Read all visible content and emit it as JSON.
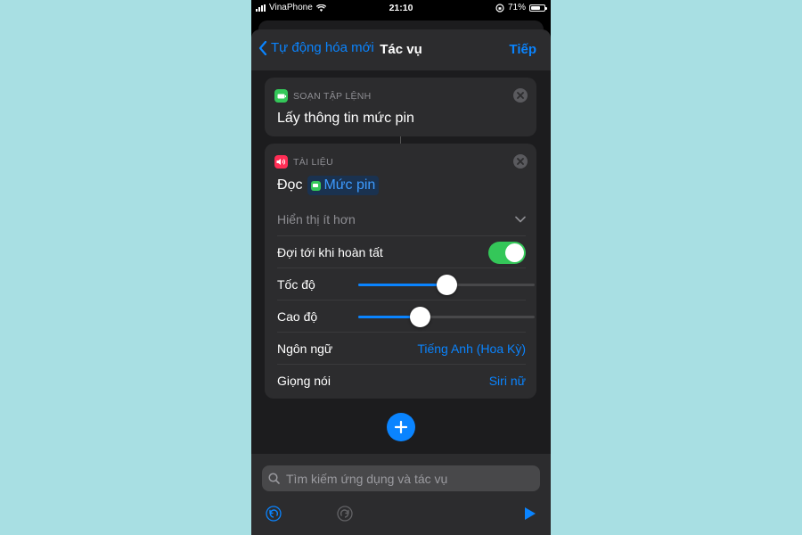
{
  "statusbar": {
    "carrier": "VinaPhone",
    "time": "21:10",
    "battery": "71%",
    "battery_level": 0.71
  },
  "nav": {
    "back_label": "Tự động hóa mới",
    "title": "Tác vụ",
    "next_label": "Tiếp"
  },
  "card1": {
    "category": "SOẠN TẬP LỆNH",
    "title": "Lấy thông tin mức pin",
    "icon": "battery-app-icon",
    "icon_color": "#34c759"
  },
  "card2": {
    "category": "TÀI LIỆU",
    "icon": "speaker-app-icon",
    "icon_color": "#ff2d55",
    "verb": "Đọc",
    "variable": "Mức pin",
    "show_less": "Hiển thị ít hơn",
    "wait_label": "Đợi tới khi hoàn tất",
    "wait_on": true,
    "rate_label": "Tốc độ",
    "rate_value": 0.5,
    "pitch_label": "Cao độ",
    "pitch_value": 0.35,
    "language_label": "Ngôn ngữ",
    "language_value": "Tiếng Anh (Hoa Kỳ)",
    "voice_label": "Giọng nói",
    "voice_value": "Siri nữ"
  },
  "search": {
    "placeholder": "Tìm kiếm ứng dụng và tác vụ"
  },
  "colors": {
    "accent": "#0a84ff",
    "toggle_on": "#34c759",
    "background": "#a8dfe3"
  }
}
